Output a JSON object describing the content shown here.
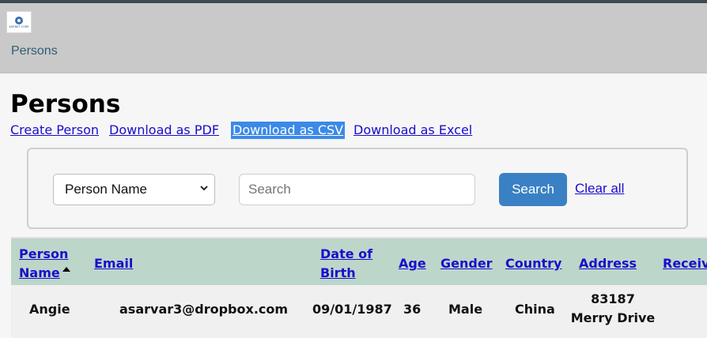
{
  "header": {
    "logo_text": "ASP.NET CORE",
    "nav_link": "Persons"
  },
  "page": {
    "title": "Persons"
  },
  "actions": {
    "create": "Create Person",
    "pdf": "Download as PDF",
    "csv": "Download as CSV",
    "excel": "Download as Excel"
  },
  "search": {
    "selected_field": "Person Name",
    "placeholder": "Search",
    "value": "",
    "button_label": "Search",
    "clear_label": "Clear all"
  },
  "table": {
    "headers": {
      "name": "Person Name",
      "email": "Email",
      "dob": "Date of Birth",
      "age": "Age",
      "gender": "Gender",
      "country": "Country",
      "address": "Address",
      "receive": "Receive"
    },
    "sorted_column": "Person Name",
    "sort_direction": "ascending",
    "rows": [
      {
        "name": "Angie",
        "email": "asarvar3@dropbox.com",
        "dob": "09/01/1987",
        "age": "36",
        "gender": "Male",
        "country": "China",
        "address": "83187 Merry Drive"
      }
    ]
  },
  "colors": {
    "header_bg": "#c9c9c9",
    "table_header_bg": "#bdd6ca",
    "link": "#1a0dcc",
    "button": "#3a80c4",
    "csv_highlight": "#3b89e8"
  }
}
